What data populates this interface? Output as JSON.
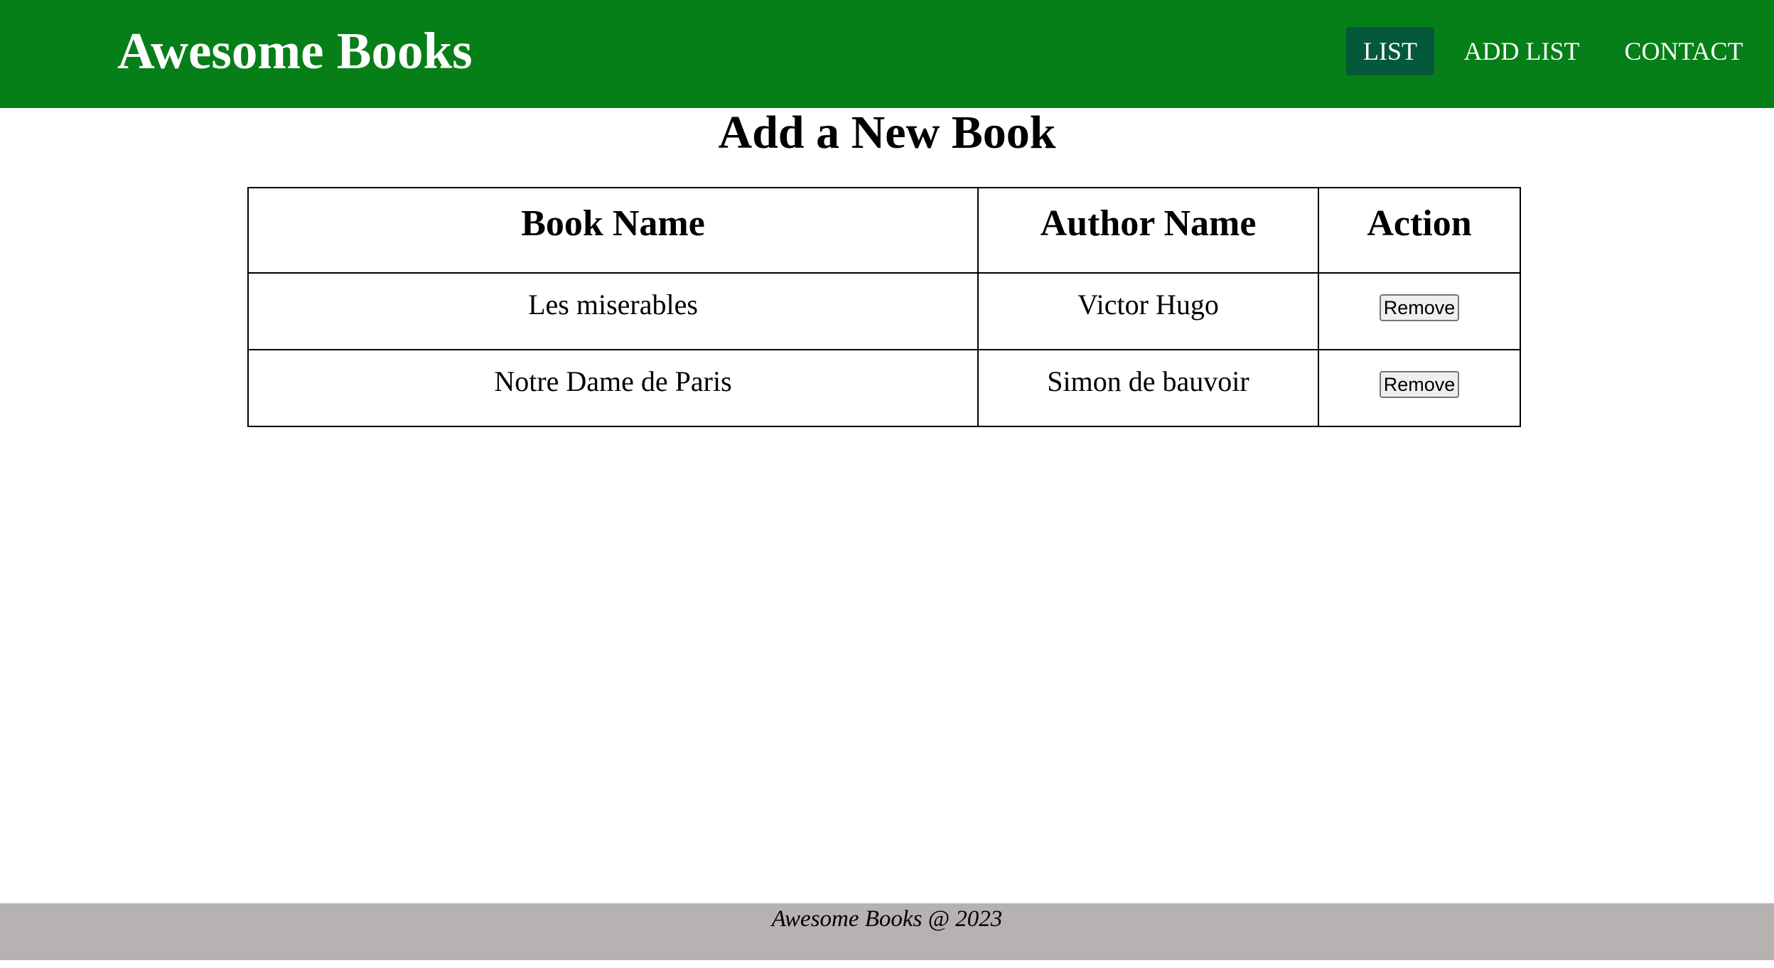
{
  "header": {
    "brand": "Awesome Books",
    "nav": [
      {
        "label": "LIST",
        "active": true
      },
      {
        "label": "ADD LIST",
        "active": false
      },
      {
        "label": "CONTACT",
        "active": false
      }
    ],
    "background_color": "#077f18",
    "active_nav_color": "#06583a"
  },
  "main": {
    "title": "Add a New Book",
    "table": {
      "headers": [
        "Book Name",
        "Author Name",
        "Action"
      ],
      "rows": [
        {
          "book": "Les miserables",
          "author": "Victor Hugo",
          "action": "Remove"
        },
        {
          "book": "Notre Dame de Paris",
          "author": "Simon de bauvoir",
          "action": "Remove"
        }
      ]
    }
  },
  "footer": {
    "text": "Awesome Books @ 2023",
    "background_color": "#b5b2b1"
  }
}
